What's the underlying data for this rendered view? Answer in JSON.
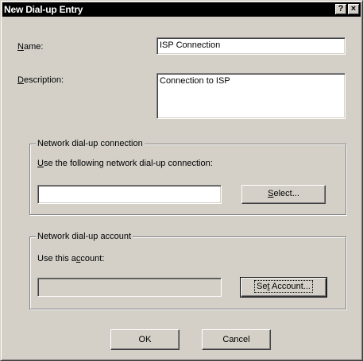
{
  "window": {
    "title": "New Dial-up Entry",
    "help_button": "?",
    "close_button": "×"
  },
  "name_field": {
    "label_mnemonic": "N",
    "label_rest": "ame:",
    "value": "ISP Connection"
  },
  "description_field": {
    "label_mnemonic": "D",
    "label_rest": "escription:",
    "value": "Connection to ISP"
  },
  "connection_group": {
    "title": "Network dial-up connection",
    "instruction_mnemonic": "U",
    "instruction_rest": "se the following network dial-up connection:",
    "value": "",
    "select_button_mnemonic": "S",
    "select_button_rest": "elect..."
  },
  "account_group": {
    "title": "Network dial-up account",
    "instruction_before": "Use this a",
    "instruction_mnemonic": "c",
    "instruction_after": "count:",
    "value": "",
    "set_account_before": "Se",
    "set_account_mnemonic": "t",
    "set_account_after": " Account..."
  },
  "footer": {
    "ok_label": "OK",
    "cancel_label": "Cancel"
  }
}
